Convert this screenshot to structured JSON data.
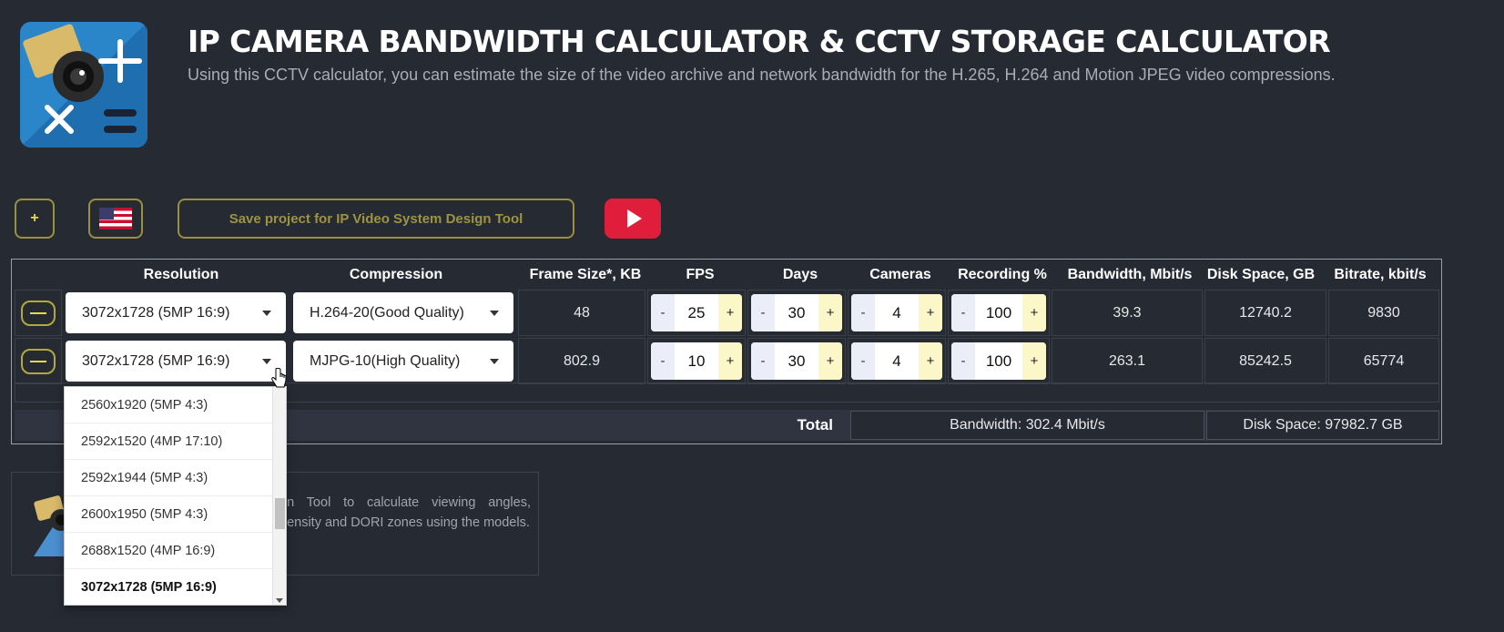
{
  "header": {
    "title": "IP CAMERA BANDWIDTH CALCULATOR & CCTV STORAGE CALCULATOR",
    "subtitle": "Using this CCTV calculator, you can estimate the size of the video archive and network bandwidth for the H.265, H.264 and Motion JPEG video compressions."
  },
  "toolbar": {
    "add_label": "+",
    "flag_icon": "us-flag-icon",
    "save_label": "Save project for IP Video System Design Tool",
    "youtube_icon": "play-icon"
  },
  "table": {
    "columns": [
      "Resolution",
      "Compression",
      "Frame Size*, KB",
      "FPS",
      "Days",
      "Cameras",
      "Recording %",
      "Bandwidth, Mbit/s",
      "Disk Space, GB",
      "Bitrate, kbit/s"
    ],
    "rows": [
      {
        "resolution": "3072x1728 (5MP 16:9)",
        "compression": "H.264-20(Good Quality)",
        "frame_size": "48",
        "fps": "25",
        "days": "30",
        "cameras": "4",
        "recording": "100",
        "bandwidth": "39.3",
        "disk_space": "12740.2",
        "bitrate": "9830"
      },
      {
        "resolution": "3072x1728 (5MP 16:9)",
        "compression": "MJPG-10(High Quality)",
        "frame_size": "802.9",
        "fps": "10",
        "days": "30",
        "cameras": "4",
        "recording": "100",
        "bandwidth": "263.1",
        "disk_space": "85242.5",
        "bitrate": "65774"
      }
    ],
    "stepper_minus": "-",
    "stepper_plus": "+",
    "total_label": "Total",
    "total_bandwidth": "Bandwidth: 302.4 Mbit/s",
    "total_disk": "Disk Space: 97982.7 GB"
  },
  "promo": {
    "text": "gn Tool to calculate viewing angles, density and DORI zones using the models."
  },
  "dropdown": {
    "options": [
      "2560x1920 (5MP 4:3)",
      "2592x1520 (4MP 17:10)",
      "2592x1944 (5MP 4:3)",
      "2600x1950 (5MP 4:3)",
      "2688x1520 (4MP 16:9)",
      "3072x1728 (5MP 16:9)"
    ],
    "selected_index": 5
  },
  "colors": {
    "background": "#262a33",
    "accent_yellow": "#e8d94a",
    "youtube_red": "#e11d3c",
    "logo_blue": "#2a86c8"
  }
}
